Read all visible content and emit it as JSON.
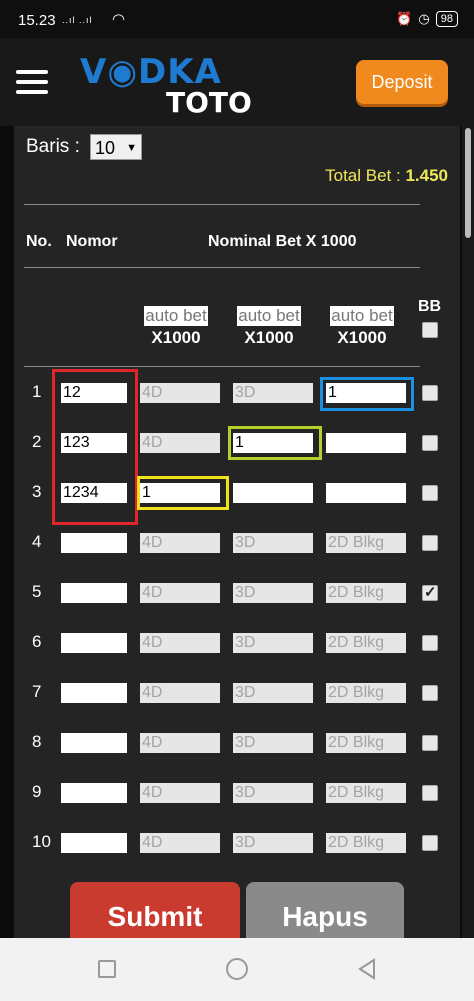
{
  "status_bar": {
    "time": "15.23",
    "signal": "..ıl ..ıl",
    "battery": "98"
  },
  "header": {
    "logo_top": "V◉DKA",
    "logo_bottom": "TOTO",
    "deposit_label": "Deposit"
  },
  "form": {
    "baris_label": "Baris :",
    "baris_value": "10",
    "total_label": "Total Bet : ",
    "total_value": "1.450",
    "col_no": "No.",
    "col_nomor": "Nomor",
    "col_nominal": "Nominal Bet X 1000",
    "col_bb": "BB",
    "auto_bet_label": "auto bet",
    "x1000_label": "X1000"
  },
  "rows": [
    {
      "no": "1",
      "nomor": "12",
      "c4d": "4D",
      "c3d": "3D",
      "c2d": "1",
      "bb": false
    },
    {
      "no": "2",
      "nomor": "123",
      "c4d": "4D",
      "c3d": "1",
      "c2d": "",
      "bb": false
    },
    {
      "no": "3",
      "nomor": "1234",
      "c4d": "1",
      "c3d": "",
      "c2d": "",
      "bb": false
    },
    {
      "no": "4",
      "nomor": "",
      "c4d": "4D",
      "c3d": "3D",
      "c2d": "2D Blkg",
      "bb": false
    },
    {
      "no": "5",
      "nomor": "",
      "c4d": "4D",
      "c3d": "3D",
      "c2d": "2D Blkg",
      "bb": true
    },
    {
      "no": "6",
      "nomor": "",
      "c4d": "4D",
      "c3d": "3D",
      "c2d": "2D Blkg",
      "bb": false
    },
    {
      "no": "7",
      "nomor": "",
      "c4d": "4D",
      "c3d": "3D",
      "c2d": "2D Blkg",
      "bb": false
    },
    {
      "no": "8",
      "nomor": "",
      "c4d": "4D",
      "c3d": "3D",
      "c2d": "2D Blkg",
      "bb": false
    },
    {
      "no": "9",
      "nomor": "",
      "c4d": "4D",
      "c3d": "3D",
      "c2d": "2D Blkg",
      "bb": false
    },
    {
      "no": "10",
      "nomor": "",
      "c4d": "4D",
      "c3d": "3D",
      "c2d": "2D Blkg",
      "bb": false
    }
  ],
  "buttons": {
    "submit": "Submit",
    "hapus": "Hapus"
  },
  "colors": {
    "submit": "#c93a2f",
    "hapus": "#8a8a8a",
    "deposit": "#f08a1e",
    "total": "#f0e85a",
    "highlight_red": "#e0262b",
    "highlight_blue": "#1d8fe0",
    "highlight_green": "#b5d02a",
    "highlight_yellow": "#f2e21a"
  }
}
